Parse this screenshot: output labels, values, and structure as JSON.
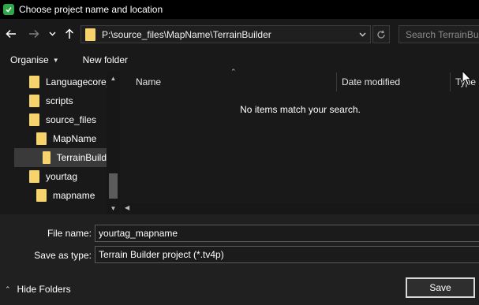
{
  "window": {
    "title": "Choose project name and location"
  },
  "address_bar": {
    "path": "P:\\source_files\\MapName\\TerrainBuilder",
    "search_placeholder": "Search TerrainBuilder"
  },
  "toolbar": {
    "organise_label": "Organise",
    "new_folder_label": "New folder"
  },
  "navigation": {
    "items": [
      {
        "label": "Languagecore_"
      },
      {
        "label": "scripts"
      },
      {
        "label": "source_files"
      },
      {
        "label": "MapName"
      },
      {
        "label": "TerrainBuild"
      },
      {
        "label": "yourtag"
      },
      {
        "label": "mapname"
      }
    ]
  },
  "file_list": {
    "columns": [
      "Name",
      "Date modified",
      "Type"
    ],
    "empty_message": "No items match your search."
  },
  "form": {
    "file_name_label": "File name:",
    "file_name_value": "yourtag_mapname",
    "save_as_type_label": "Save as type:",
    "save_as_type_value": "Terrain Builder project (*.tv4p)"
  },
  "footer": {
    "hide_folders_label": "Hide Folders",
    "save_label": "Save"
  },
  "colors": {
    "folder": "#f6d36c",
    "app_icon": "#2fa84a",
    "background": "#191919"
  }
}
